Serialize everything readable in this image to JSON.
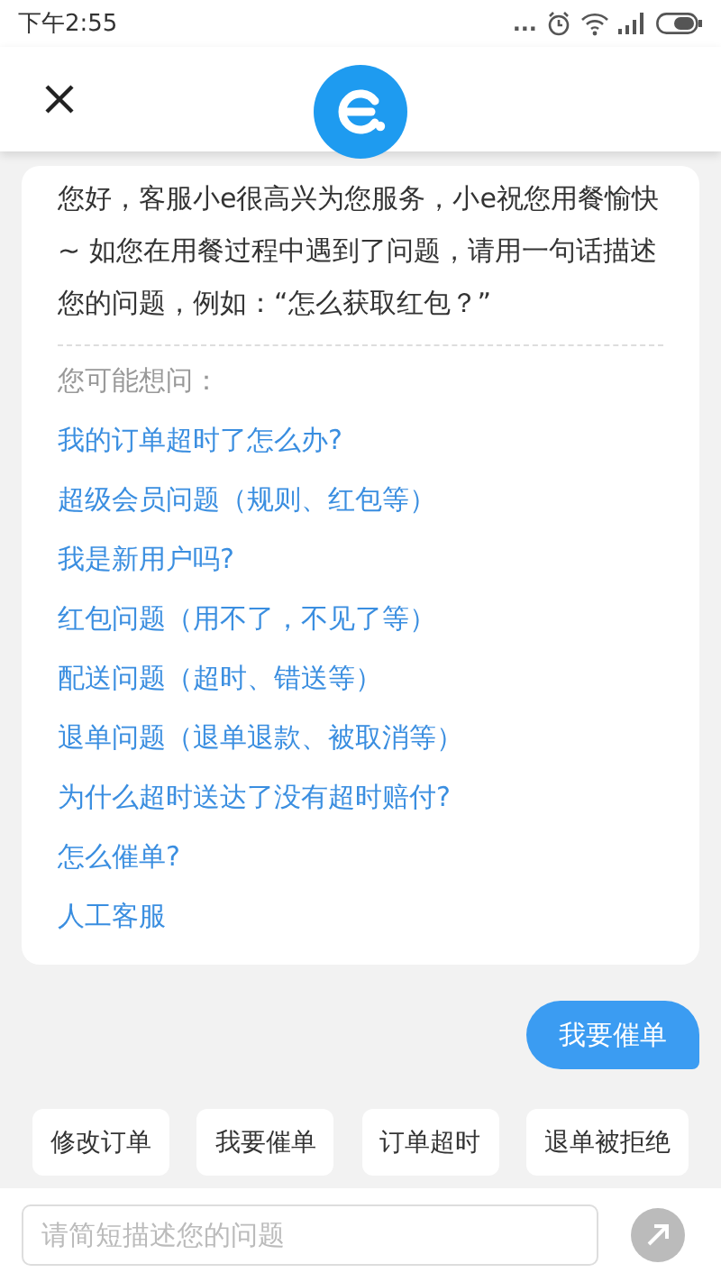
{
  "status_bar": {
    "time": "下午2:55",
    "dots": "..."
  },
  "greeting": "您好，客服小e很高兴为您服务，小e祝您用餐愉快~ 如您在用餐过程中遇到了问题，请用一句话描述您的问题，例如：“怎么获取红包？”",
  "suggestions_title": "您可能想问：",
  "suggestions": [
    "我的订单超时了怎么办?",
    "超级会员问题（规则、红包等）",
    "我是新用户吗?",
    "红包问题（用不了，不见了等）",
    "配送问题（超时、错送等）",
    "退单问题（退单退款、被取消等）",
    "为什么超时送达了没有超时赔付?",
    "怎么催单?",
    "人工客服"
  ],
  "user_message": "我要催单",
  "quick_replies": [
    "修改订单",
    "我要催单",
    "订单超时",
    "退单被拒绝"
  ],
  "input": {
    "placeholder": "请简短描述您的问题"
  }
}
